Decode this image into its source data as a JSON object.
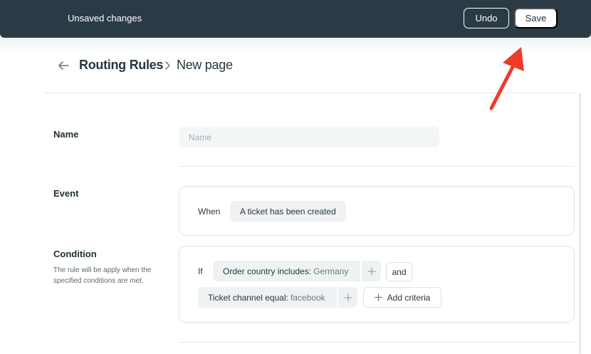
{
  "topbar": {
    "message": "Unsaved changes",
    "undo_label": "Undo",
    "save_label": "Save"
  },
  "breadcrumb": {
    "root": "Routing Rules",
    "current": "New page"
  },
  "form": {
    "name": {
      "label": "Name",
      "placeholder": "Name",
      "value": ""
    },
    "event": {
      "label": "Event",
      "keyword": "When",
      "trigger": "A ticket has been created"
    },
    "condition": {
      "label": "Condition",
      "helper": "The rule will be apply when the specified conditions are met.",
      "keyword": "If",
      "criteria": [
        {
          "field": "Order country includes:",
          "value": "Germany"
        },
        {
          "field": "Ticket channel equal:",
          "value": "facebook"
        }
      ],
      "joiner": "and",
      "add_label": "Add criteria"
    }
  },
  "annotation": {
    "arrow_color": "#ef3a27"
  },
  "colors": {
    "topbar_bg": "#2a3b46",
    "pill_bg": "#eef2f3",
    "input_bg": "#f3f6f7"
  }
}
